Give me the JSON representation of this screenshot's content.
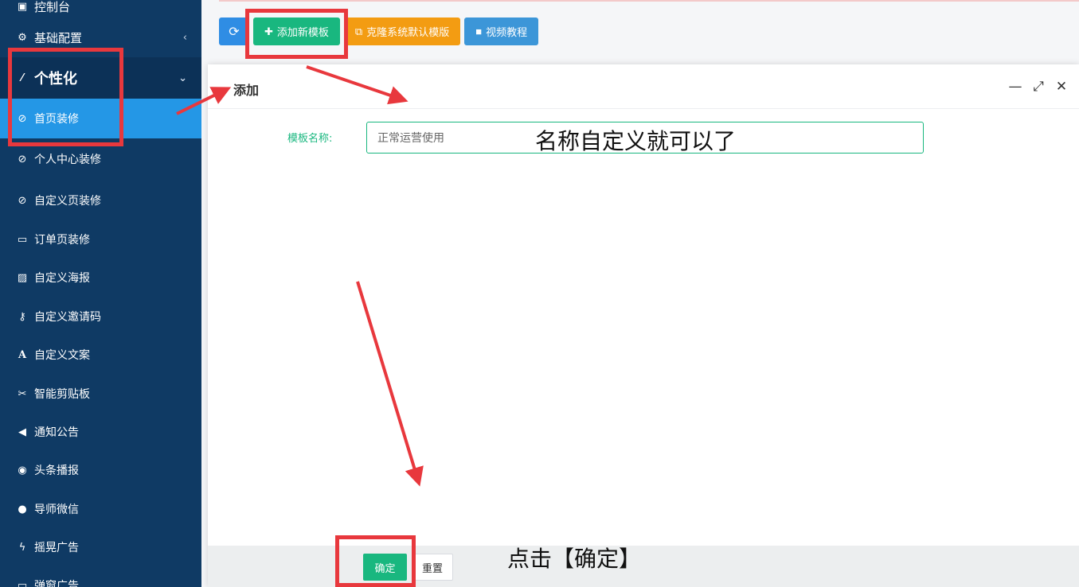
{
  "sidebar": {
    "items": [
      {
        "label": "控制台",
        "icon": "dashboard-icon"
      },
      {
        "label": "基础配置",
        "icon": "gears-icon"
      },
      {
        "label": "个性化",
        "icon": "magic-wand-icon"
      },
      {
        "label": "首页装修",
        "icon": "ban-icon"
      },
      {
        "label": "个人中心装修",
        "icon": "ban-icon"
      },
      {
        "label": "自定义页装修",
        "icon": "ban-icon"
      },
      {
        "label": "订单页装修",
        "icon": "window-icon"
      },
      {
        "label": "自定义海报",
        "icon": "image-icon"
      },
      {
        "label": "自定义邀请码",
        "icon": "key-icon"
      },
      {
        "label": "自定义文案",
        "icon": "font-icon"
      },
      {
        "label": "智能剪贴板",
        "icon": "scissors-icon"
      },
      {
        "label": "通知公告",
        "icon": "bullhorn-icon"
      },
      {
        "label": "头条播报",
        "icon": "podcast-icon"
      },
      {
        "label": "导师微信",
        "icon": "wechat-icon"
      },
      {
        "label": "摇晃广告",
        "icon": "bolt-icon"
      },
      {
        "label": "弹窗广告",
        "icon": "window-icon"
      }
    ]
  },
  "toolbar": {
    "refresh_icon": "refresh-icon",
    "add_label": "添加新模板",
    "clone_label": "克隆系统默认模版",
    "video_label": "视频教程"
  },
  "modal": {
    "title": "添加",
    "field_label": "模板名称:",
    "field_value": "正常运营使用",
    "ok_label": "确定",
    "reset_label": "重置"
  },
  "annotations": {
    "note_name": "名称自定义就可以了",
    "note_confirm": "点击【确定】",
    "color": "#e8383d"
  }
}
